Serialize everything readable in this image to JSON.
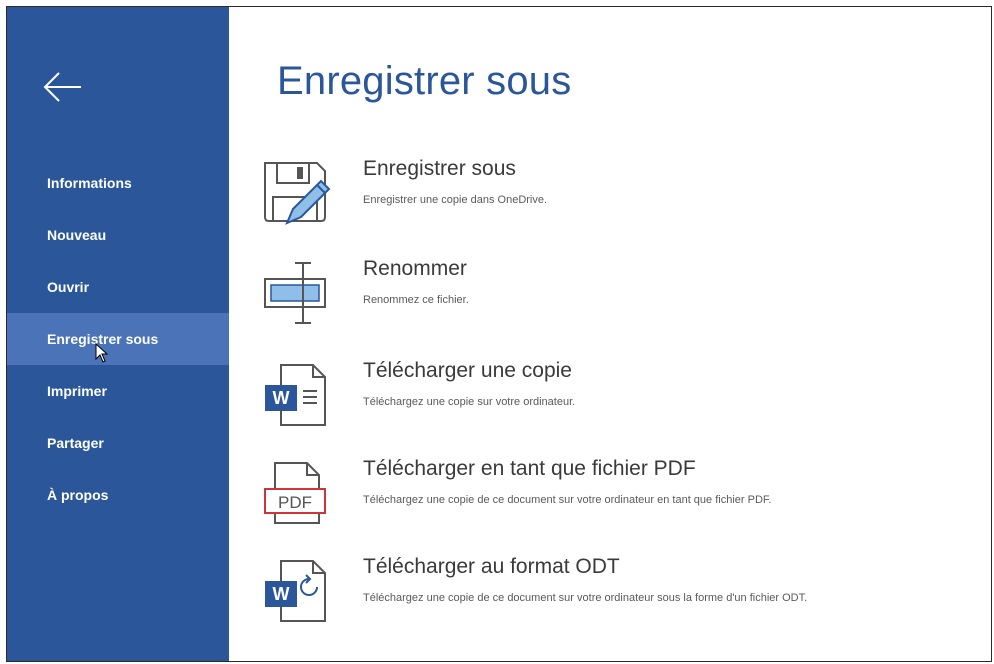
{
  "sidebar": {
    "items": [
      {
        "id": "informations",
        "label": "Informations"
      },
      {
        "id": "nouveau",
        "label": "Nouveau"
      },
      {
        "id": "ouvrir",
        "label": "Ouvrir"
      },
      {
        "id": "enregistrer-sous",
        "label": "Enregistrer sous",
        "active": true
      },
      {
        "id": "imprimer",
        "label": "Imprimer"
      },
      {
        "id": "partager",
        "label": "Partager"
      },
      {
        "id": "a-propos",
        "label": "À propos"
      }
    ]
  },
  "main": {
    "title": "Enregistrer sous",
    "options": [
      {
        "title": "Enregistrer sous",
        "desc": "Enregistrer une copie dans OneDrive.",
        "icon": "save-as-icon"
      },
      {
        "title": "Renommer",
        "desc": "Renommez ce fichier.",
        "icon": "rename-icon"
      },
      {
        "title": "Télécharger une copie",
        "desc": "Téléchargez une copie sur votre ordinateur.",
        "icon": "word-document-icon"
      },
      {
        "title": "Télécharger en tant que fichier PDF",
        "desc": "Téléchargez une copie de ce document sur votre ordinateur en tant que fichier PDF.",
        "icon": "pdf-document-icon",
        "icon_text": "PDF"
      },
      {
        "title": "Télécharger au format ODT",
        "desc": "Téléchargez une copie de ce document sur votre ordinateur sous la forme d'un fichier ODT.",
        "icon": "word-odt-document-icon"
      }
    ]
  },
  "colors": {
    "sidebar_bg": "#2b579a",
    "sidebar_active_bg": "#4a73b8",
    "title": "#2b579a",
    "word_blue": "#2b579a",
    "pdf_red": "#d13438"
  }
}
